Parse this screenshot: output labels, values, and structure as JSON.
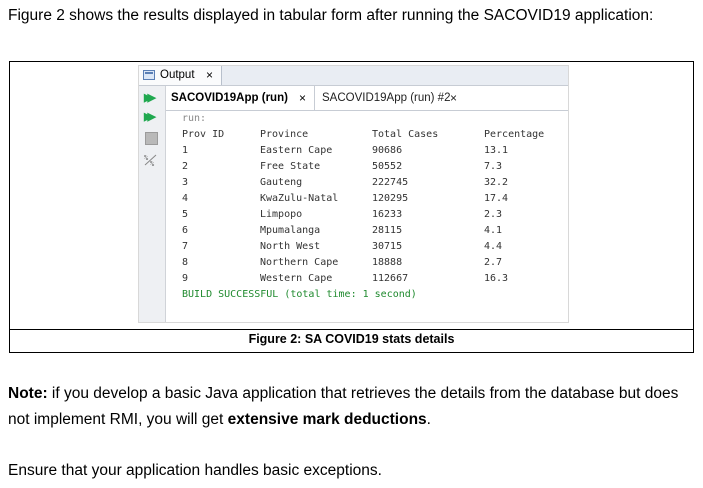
{
  "intro": "Figure 2 shows the results displayed in tabular form after running the SACOVID19 application:",
  "ide": {
    "output_tab": "Output",
    "close_glyph": "×",
    "run_tabs": [
      {
        "label": "SACOVID19App (run)"
      },
      {
        "label": "SACOVID19App (run) #2"
      }
    ],
    "console": {
      "run_line": "run:",
      "headers": [
        "Prov ID",
        "Province",
        "Total Cases",
        "Percentage"
      ],
      "rows": [
        [
          "1",
          "Eastern Cape",
          "90686",
          "13.1"
        ],
        [
          "2",
          "Free State",
          "50552",
          "7.3"
        ],
        [
          "3",
          "Gauteng",
          "222745",
          "32.2"
        ],
        [
          "4",
          "KwaZulu-Natal",
          "120295",
          "17.4"
        ],
        [
          "5",
          "Limpopo",
          "16233",
          "2.3"
        ],
        [
          "6",
          "Mpumalanga",
          "28115",
          "4.1"
        ],
        [
          "7",
          "North West",
          "30715",
          "4.4"
        ],
        [
          "8",
          "Northern Cape",
          "18888",
          "2.7"
        ],
        [
          "9",
          "Western Cape",
          "112667",
          "16.3"
        ]
      ],
      "build": "BUILD SUCCESSFUL (total time: 1 second)"
    },
    "icons": {
      "rerun": "double-play-icon",
      "rerun2": "double-play-icon",
      "stop": "stop-icon",
      "wrap": "wrap-lines-icon"
    }
  },
  "caption": "Figure 2: SA COVID19 stats details",
  "note": {
    "label": "Note:",
    "part1": " if you develop a basic Java application that retrieves the details from the database but does not implement RMI, you will get ",
    "emphasis": "extensive mark deductions",
    "part2": "."
  },
  "ensure": "Ensure that your application handles basic exceptions."
}
